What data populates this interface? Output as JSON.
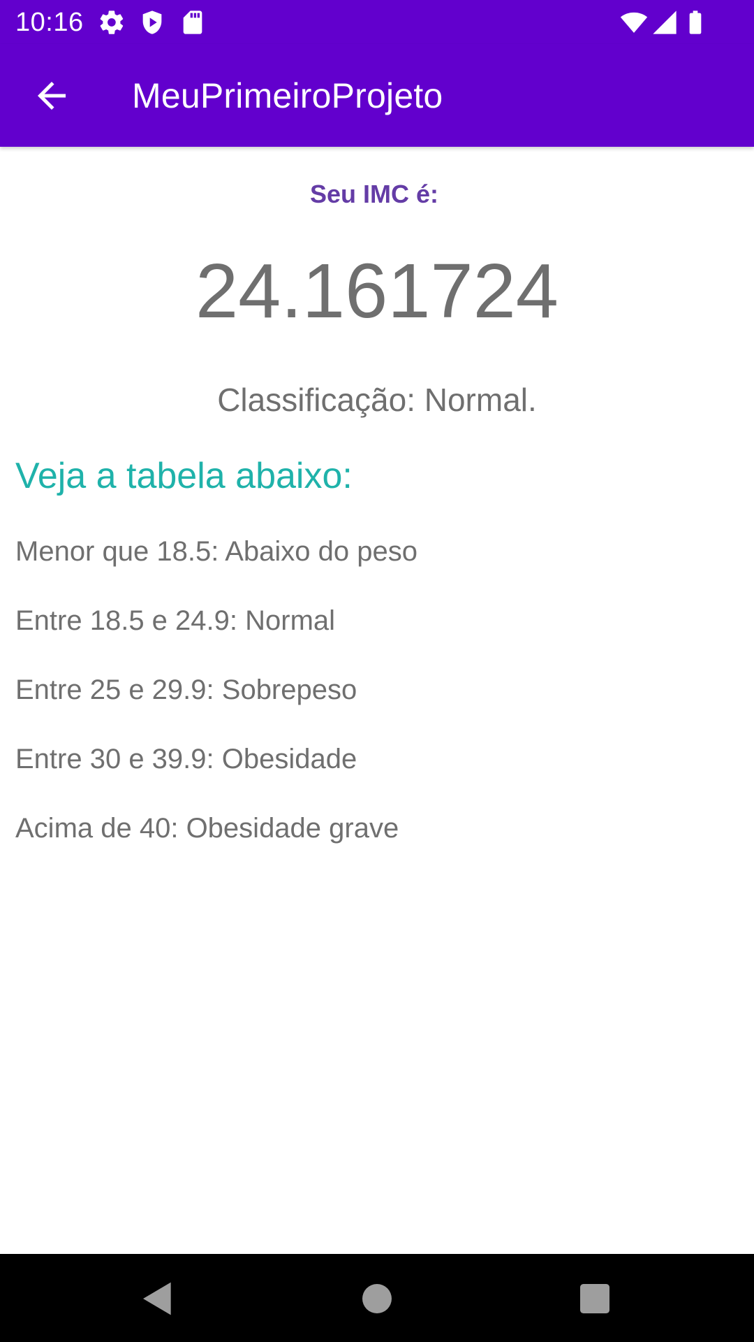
{
  "status_bar": {
    "time": "10:16",
    "left_icons": [
      "gear-icon",
      "shield-icon",
      "sd-card-icon"
    ],
    "right_icons": [
      "wifi-icon",
      "signal-icon",
      "battery-icon"
    ]
  },
  "app_bar": {
    "title": "MeuPrimeiroProjeto",
    "back_icon": "arrow-back-icon"
  },
  "result": {
    "label": "Seu IMC é:",
    "value": "24.161724",
    "classification": "Classificação: Normal."
  },
  "table": {
    "heading": "Veja a tabela abaixo:",
    "rows": [
      "Menor que 18.5: Abaixo do peso",
      "Entre 18.5 e 24.9: Normal",
      "Entre 25 e 29.9: Sobrepeso",
      "Entre 30 e 39.9: Obesidade",
      "Acima de 40: Obesidade grave"
    ]
  },
  "nav_bar": {
    "buttons": [
      "back-triangle-icon",
      "home-circle-icon",
      "recents-square-icon"
    ]
  },
  "colors": {
    "primary": "#6200cd",
    "label_purple": "#643ca6",
    "heading_teal": "#1fb2aa",
    "text_gray": "#6f6f6f",
    "nav_black": "#000000"
  }
}
